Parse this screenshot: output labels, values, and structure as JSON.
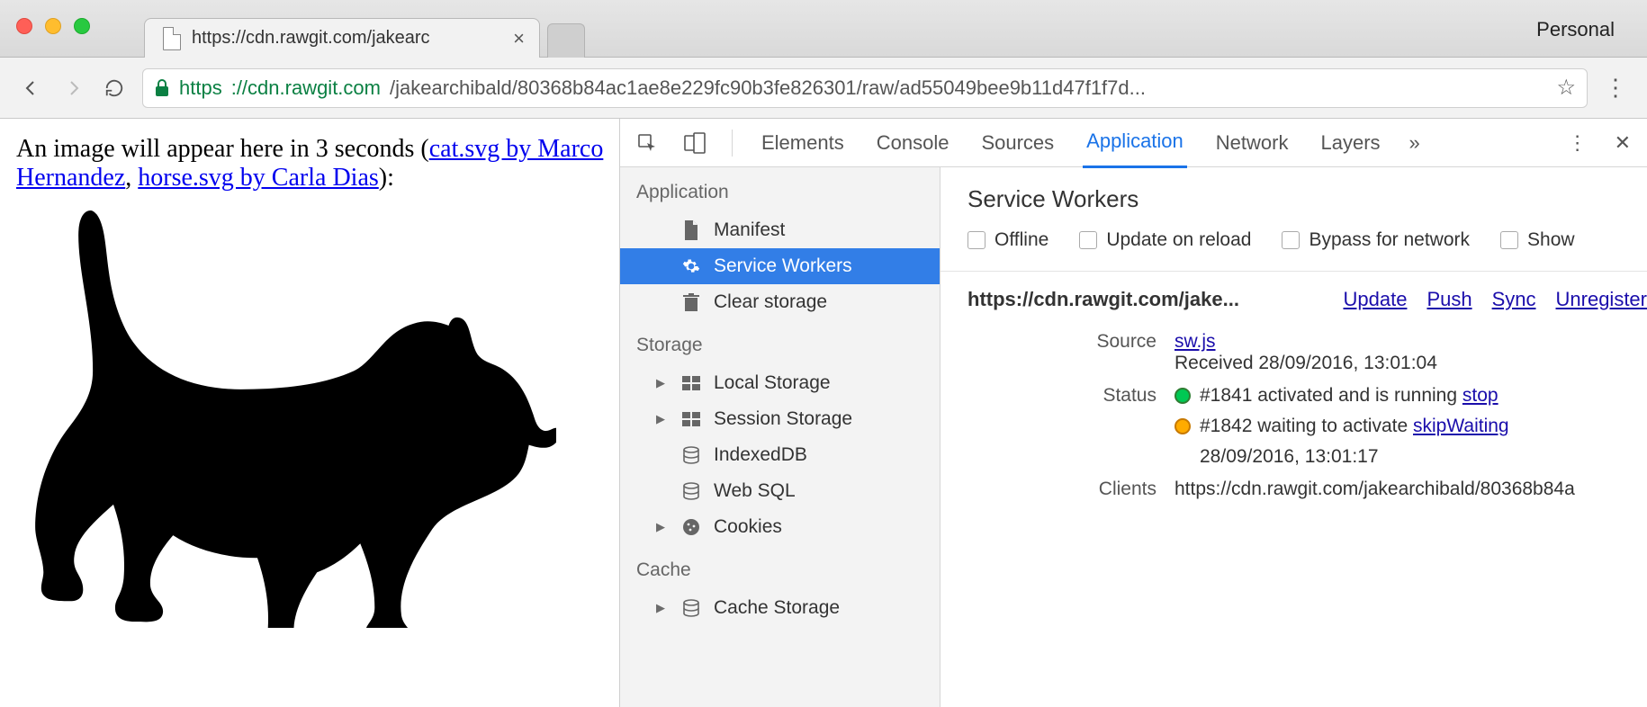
{
  "window": {
    "personal_label": "Personal",
    "tab_title": "https://cdn.rawgit.com/jakearc",
    "url_secure_prefix": "https",
    "url_after_scheme": "://cdn.rawgit.com",
    "url_path": "/jakearchibald/80368b84ac1ae8e229fc90b3fe826301/raw/ad55049bee9b11d47f1f7d..."
  },
  "page": {
    "text_prefix": "An image will appear here in 3 seconds (",
    "link1": "cat.svg by Marco Hernandez",
    "mid": ", ",
    "link2": "horse.svg by Carla Dias",
    "text_suffix": "):"
  },
  "devtools": {
    "tabs": [
      "Elements",
      "Console",
      "Sources",
      "Application",
      "Network",
      "Layers"
    ],
    "active_tab": "Application",
    "sidebar": {
      "groups": [
        {
          "title": "Application",
          "items": [
            {
              "label": "Manifest",
              "icon": "file-icon",
              "selected": false,
              "expandable": false
            },
            {
              "label": "Service Workers",
              "icon": "gear-icon",
              "selected": true,
              "expandable": false
            },
            {
              "label": "Clear storage",
              "icon": "trash-icon",
              "selected": false,
              "expandable": false
            }
          ]
        },
        {
          "title": "Storage",
          "items": [
            {
              "label": "Local Storage",
              "icon": "grid-icon",
              "selected": false,
              "expandable": true
            },
            {
              "label": "Session Storage",
              "icon": "grid-icon",
              "selected": false,
              "expandable": true
            },
            {
              "label": "IndexedDB",
              "icon": "db-icon",
              "selected": false,
              "expandable": false
            },
            {
              "label": "Web SQL",
              "icon": "db-icon",
              "selected": false,
              "expandable": false
            },
            {
              "label": "Cookies",
              "icon": "cookie-icon",
              "selected": false,
              "expandable": true
            }
          ]
        },
        {
          "title": "Cache",
          "items": [
            {
              "label": "Cache Storage",
              "icon": "db-icon",
              "selected": false,
              "expandable": true
            }
          ]
        }
      ]
    },
    "pane": {
      "title": "Service Workers",
      "checks": [
        "Offline",
        "Update on reload",
        "Bypass for network",
        "Show"
      ],
      "origin": "https://cdn.rawgit.com/jake...",
      "action_links": [
        "Update",
        "Push",
        "Sync",
        "Unregister"
      ],
      "source_label": "Source",
      "source_link": "sw.js",
      "received": "Received 28/09/2016, 13:01:04",
      "status_label": "Status",
      "statuses": [
        {
          "dot": "green",
          "text": "#1841 activated and is running",
          "action": "stop"
        },
        {
          "dot": "orange",
          "text": "#1842 waiting to activate",
          "action": "skipWaiting",
          "sub": "28/09/2016, 13:01:17"
        }
      ],
      "clients_label": "Clients",
      "clients_value": "https://cdn.rawgit.com/jakearchibald/80368b84a"
    }
  }
}
